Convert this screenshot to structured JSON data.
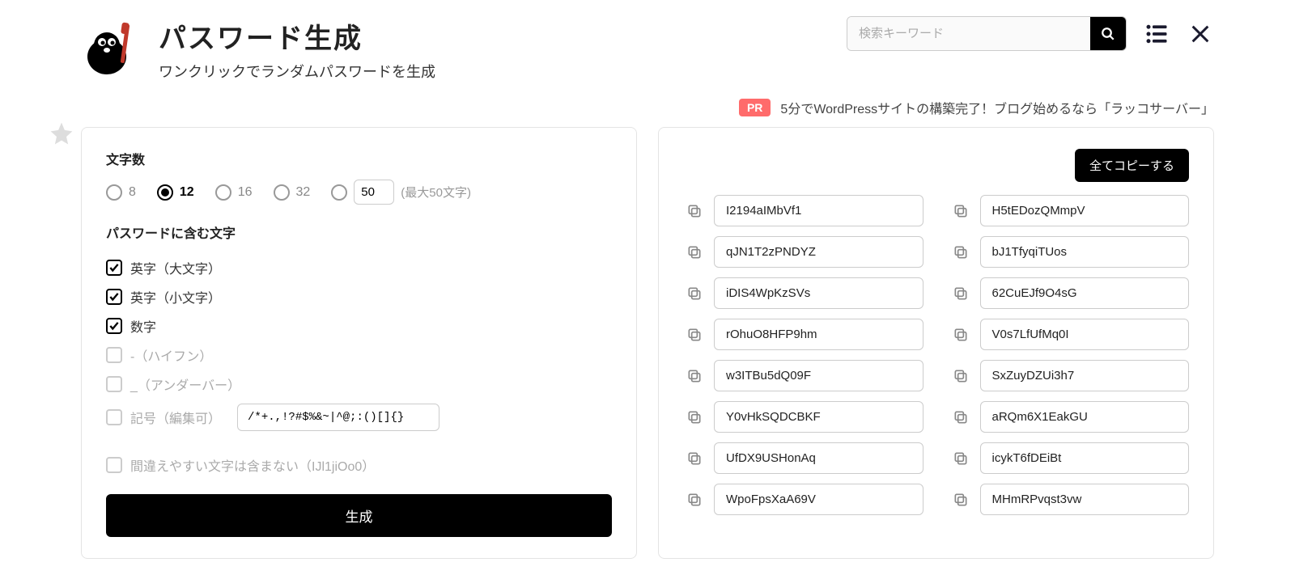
{
  "header": {
    "title": "パスワード生成",
    "subtitle": "ワンクリックでランダムパスワードを生成",
    "search_placeholder": "検索キーワード"
  },
  "pr": {
    "badge": "PR",
    "text": "5分でWordPressサイトの構築完了！ブログ始めるなら「ラッコサーバー」"
  },
  "settings": {
    "length_label": "文字数",
    "length_options": [
      "8",
      "12",
      "16",
      "32"
    ],
    "length_selected": "12",
    "length_custom": "50",
    "length_max_hint": "(最大50文字)",
    "chars_label": "パスワードに含む文字",
    "checks": [
      {
        "label": "英字（大文字）",
        "checked": true
      },
      {
        "label": "英字（小文字）",
        "checked": true
      },
      {
        "label": "数字",
        "checked": true
      },
      {
        "label": "-（ハイフン）",
        "checked": false
      },
      {
        "label": "_（アンダーバー）",
        "checked": false
      },
      {
        "label": "記号（編集可）",
        "checked": false
      }
    ],
    "symbols_value": "/*+.,!?#$%&~|^@;:()[]{}",
    "confusing_label": "間違えやすい文字は含まない（IJl1jiOo0）",
    "generate_label": "生成"
  },
  "results": {
    "copy_all_label": "全てコピーする",
    "passwords": [
      "I2194aIMbVf1",
      "H5tEDozQMmpV",
      "qJN1T2zPNDYZ",
      "bJ1TfyqiTUos",
      "iDIS4WpKzSVs",
      "62CuEJf9O4sG",
      "rOhuO8HFP9hm",
      "V0s7LfUfMq0I",
      "w3ITBu5dQ09F",
      "SxZuyDZUi3h7",
      "Y0vHkSQDCBKF",
      "aRQm6X1EakGU",
      "UfDX9USHonAq",
      "icykT6fDEiBt",
      "WpoFpsXaA69V",
      "MHmRPvqst3vw"
    ]
  }
}
